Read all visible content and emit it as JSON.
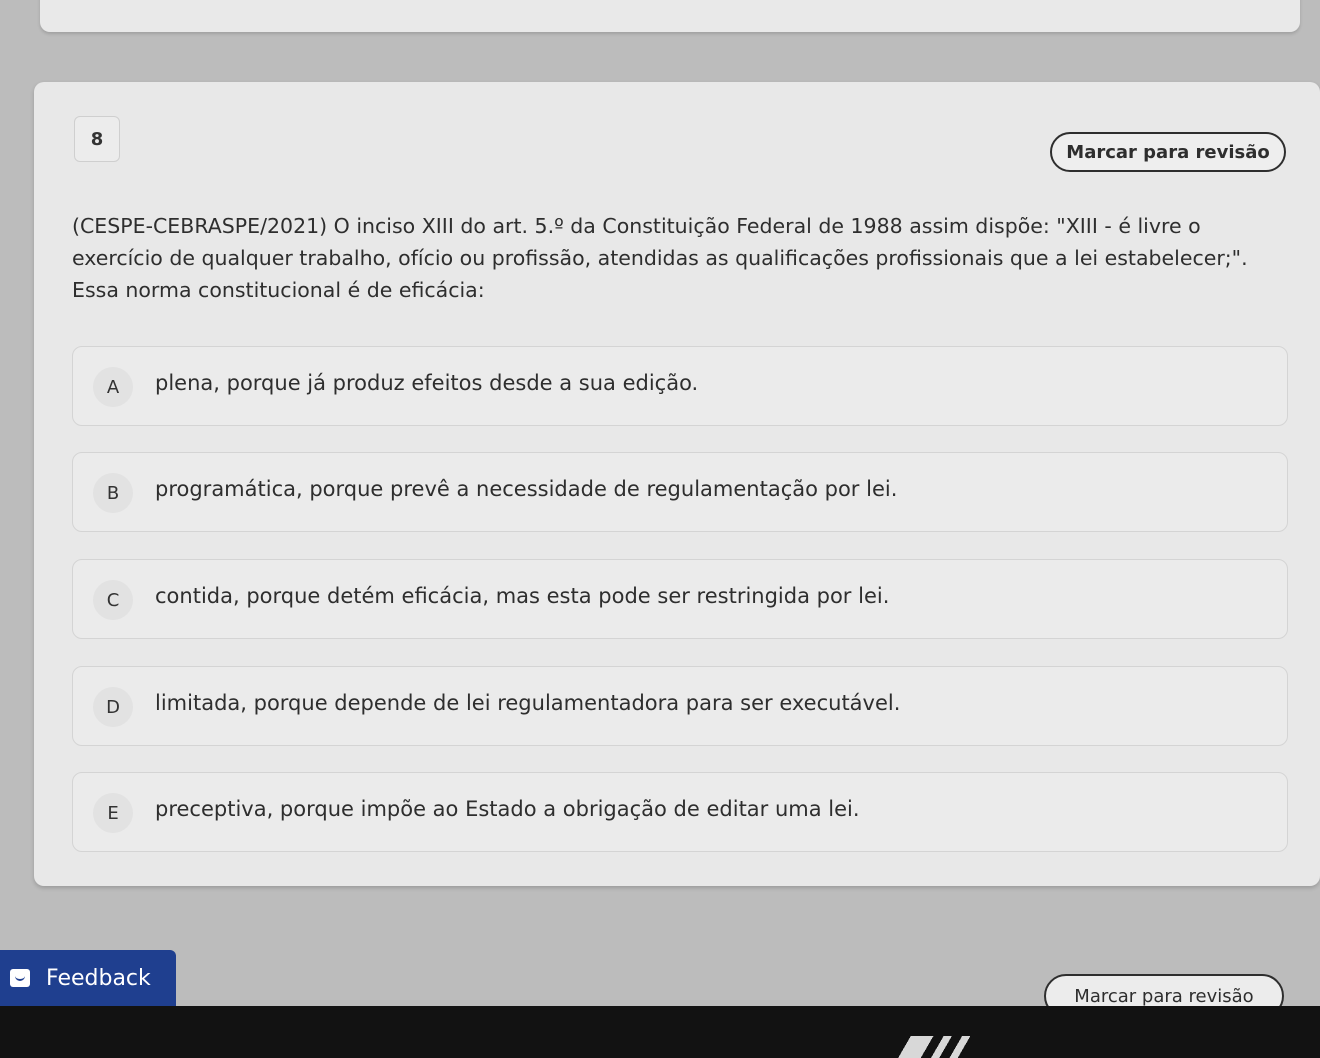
{
  "question": {
    "number": "8",
    "review_label": "Marcar para revisão",
    "statement": "(CESPE-CEBRASPE/2021) O inciso XIII do art. 5.º da Constituição Federal de 1988 assim dispõe: \"XIII - é livre o exercício de qualquer trabalho, ofício ou profissão, atendidas as qualificações profissionais que a lei estabelecer;\". Essa norma constitucional é de eficácia:",
    "options": [
      {
        "letter": "A",
        "text": "plena, porque já produz efeitos desde a sua edição."
      },
      {
        "letter": "B",
        "text": "programática, porque prevê a necessidade de regulamentação por lei."
      },
      {
        "letter": "C",
        "text": "contida, porque detém eficácia, mas esta pode ser restringida por lei."
      },
      {
        "letter": "D",
        "text": "limitada, porque depende de lei regulamentadora para ser executável."
      },
      {
        "letter": "E",
        "text": "preceptiva, porque impõe ao Estado a obrigação de editar uma lei."
      }
    ]
  },
  "feedback": {
    "label": "Feedback",
    "icon": "smiley-feedback-icon"
  },
  "footer": {
    "review_label": "Marcar para revisão"
  },
  "colors": {
    "feedback_bg": "#1f3f8f",
    "card_bg": "#e8e8e8",
    "text": "#2e2e2e"
  }
}
